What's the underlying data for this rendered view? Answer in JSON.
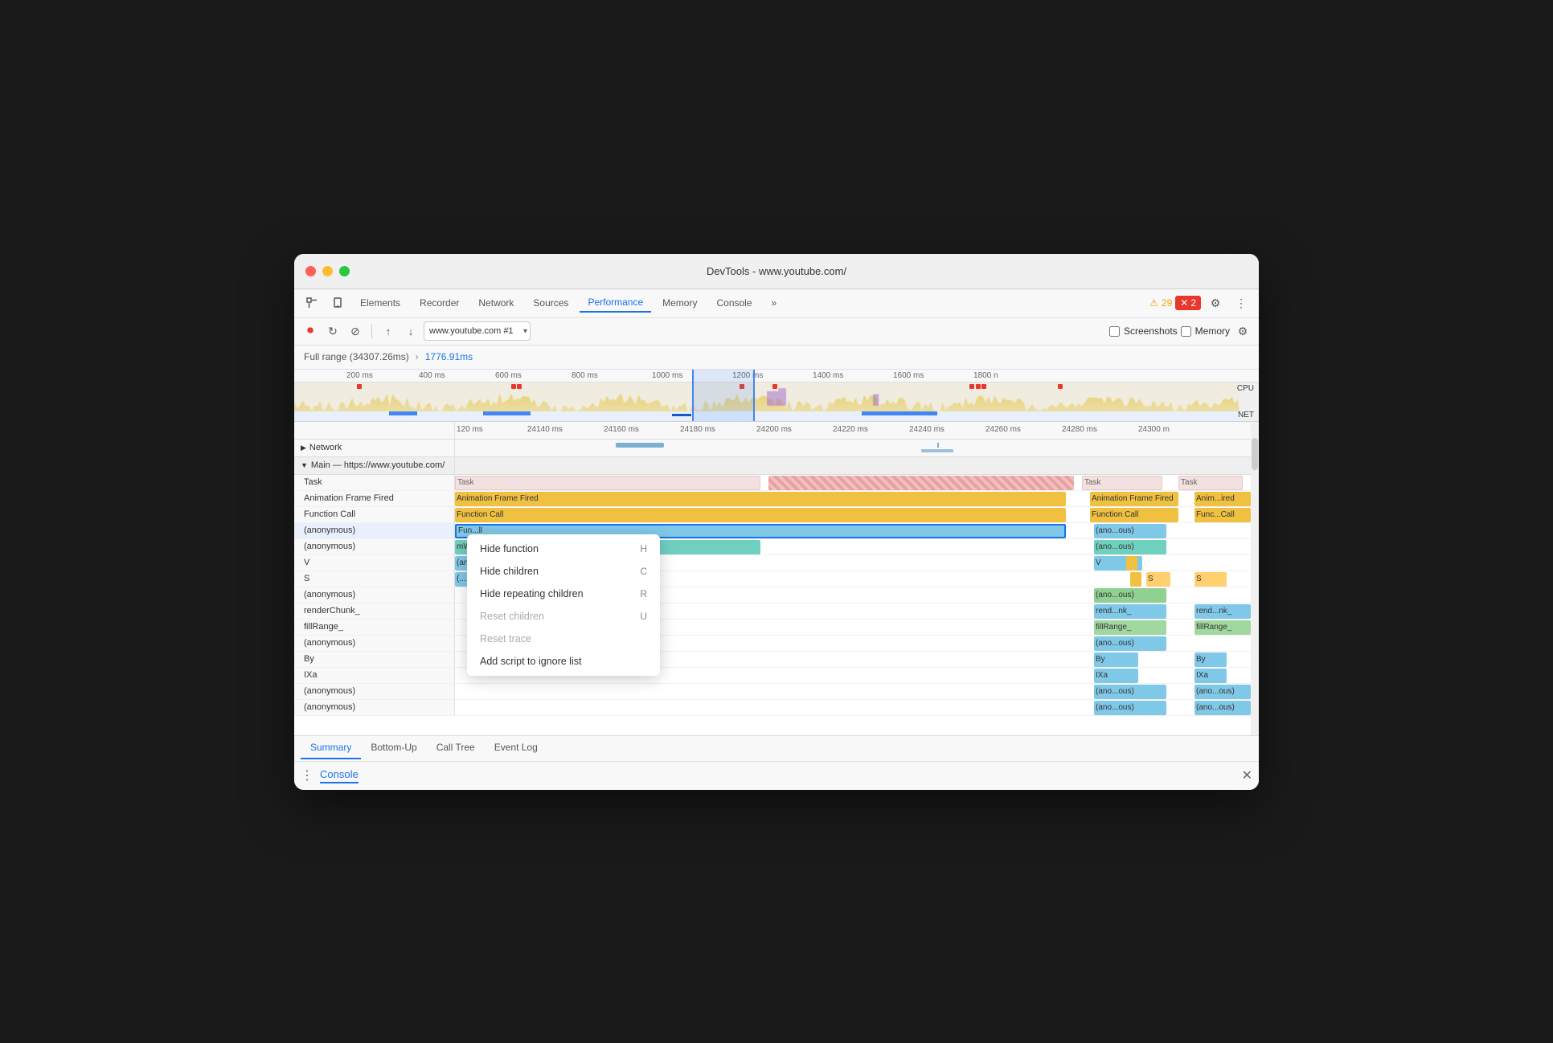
{
  "window": {
    "title": "DevTools - www.youtube.com/"
  },
  "nav": {
    "tabs": [
      {
        "label": "Elements",
        "active": false
      },
      {
        "label": "Recorder",
        "active": false
      },
      {
        "label": "Network",
        "active": false
      },
      {
        "label": "Sources",
        "active": false
      },
      {
        "label": "Performance",
        "active": true
      },
      {
        "label": "Memory",
        "active": false
      },
      {
        "label": "Console",
        "active": false
      },
      {
        "label": "»",
        "active": false
      }
    ],
    "warnings": "29",
    "errors": "2"
  },
  "toolbar": {
    "record_label": "Record",
    "url": "www.youtube.com #1",
    "screenshots_label": "Screenshots",
    "memory_label": "Memory"
  },
  "range": {
    "full": "Full range (34307.26ms)",
    "arrow": "›",
    "selected": "1776.91ms"
  },
  "timeline": {
    "ruler_marks": [
      "200 ms",
      "400 ms",
      "600 ms",
      "800 ms",
      "1000 ms",
      "1200 ms",
      "1400 ms",
      "1600 ms",
      "1800 n"
    ],
    "detail_marks": [
      "120 ms",
      "24140 ms",
      "24160 ms",
      "24180 ms",
      "24200 ms",
      "24220 ms",
      "24240 ms",
      "24260 ms",
      "24280 ms",
      "24300 m"
    ],
    "cpu_label": "CPU",
    "net_label": "NET"
  },
  "tracks": {
    "network_label": "Network",
    "main_label": "Main — https://www.youtube.com/"
  },
  "flame_rows": [
    {
      "label": "Task",
      "cols": [
        "Task",
        "Task"
      ]
    },
    {
      "label": "Animation Frame Fired",
      "cols": [
        "Animation Frame Fired",
        "Anim...ired"
      ]
    },
    {
      "label": "Function Call",
      "cols": [
        "Function Call",
        "Func...Call"
      ]
    },
    {
      "label": "(anonymous)",
      "cols": [
        "Fun...ll",
        "(ano...ous)"
      ],
      "selected": true
    },
    {
      "label": "(anonymous)",
      "cols": [
        "mWa",
        "(ano...ous)"
      ]
    },
    {
      "label": "V",
      "cols": [
        "(an...s)",
        "V"
      ]
    },
    {
      "label": "S",
      "cols": [
        "(...",
        "S"
      ]
    },
    {
      "label": "(anonymous)",
      "cols": [
        "",
        "(ano...ous)"
      ]
    },
    {
      "label": "renderChunk_",
      "cols": [
        "",
        "rend...nk_"
      ]
    },
    {
      "label": "fillRange_",
      "cols": [
        "",
        "fillRange_"
      ]
    },
    {
      "label": "(anonymous)",
      "cols": [
        "",
        "(ano...ous)"
      ]
    },
    {
      "label": "By",
      "cols": [
        "",
        "By"
      ]
    },
    {
      "label": "IXa",
      "cols": [
        "",
        "IXa"
      ]
    },
    {
      "label": "(anonymous)",
      "cols": [
        "",
        "(ano...ous)"
      ]
    },
    {
      "label": "(anonymous)",
      "cols": [
        "",
        "(ano...ous)"
      ]
    }
  ],
  "context_menu": {
    "items": [
      {
        "label": "Hide function",
        "shortcut": "H",
        "disabled": false
      },
      {
        "label": "Hide children",
        "shortcut": "C",
        "disabled": false
      },
      {
        "label": "Hide repeating children",
        "shortcut": "R",
        "disabled": false
      },
      {
        "label": "Reset children",
        "shortcut": "U",
        "disabled": true
      },
      {
        "label": "Reset trace",
        "shortcut": "",
        "disabled": true
      },
      {
        "label": "Add script to ignore list",
        "shortcut": "",
        "disabled": false
      }
    ]
  },
  "bottom_tabs": [
    {
      "label": "Summary",
      "active": true
    },
    {
      "label": "Bottom-Up",
      "active": false
    },
    {
      "label": "Call Tree",
      "active": false
    },
    {
      "label": "Event Log",
      "active": false
    }
  ],
  "console_bar": {
    "dots": "⋮",
    "tab_label": "Console",
    "close": "✕"
  }
}
